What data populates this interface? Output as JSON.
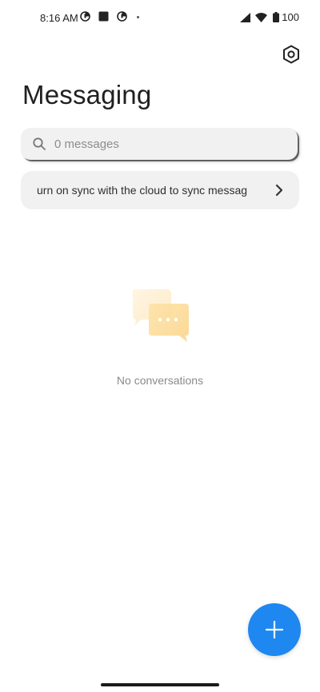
{
  "status_bar": {
    "time": "8:16 AM",
    "battery": "100",
    "icons_left": [
      "notification-icon",
      "square-icon",
      "notification-icon",
      "dot-icon"
    ],
    "icons_right": [
      "signal-icon",
      "wifi-icon",
      "battery-icon"
    ]
  },
  "header": {
    "title": "Messaging",
    "settings_icon": "settings-icon"
  },
  "search": {
    "placeholder": "0 messages"
  },
  "sync_banner": {
    "text": "urn on sync with the cloud to sync messag"
  },
  "empty_state": {
    "text": "No conversations"
  },
  "fab": {
    "icon": "plus-icon",
    "color": "#1e88f0"
  }
}
